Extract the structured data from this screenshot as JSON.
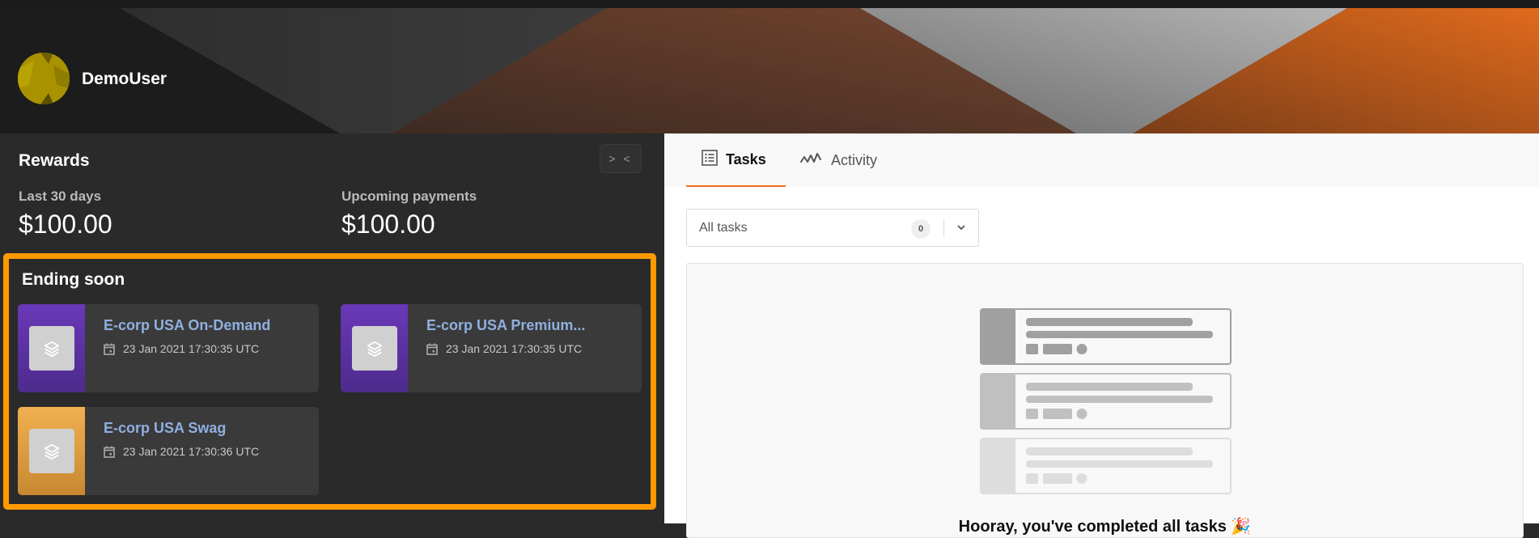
{
  "header": {
    "username": "DemoUser",
    "avatar_icon": "user-avatar-icon"
  },
  "rewards": {
    "title": "Rewards",
    "collapse_label": "> <",
    "last_30_days": {
      "label": "Last 30 days",
      "value": "$100.00"
    },
    "upcoming_payments": {
      "label": "Upcoming payments",
      "value": "$100.00"
    }
  },
  "ending_soon": {
    "title": "Ending soon",
    "items": [
      {
        "title": "E-corp USA On-Demand",
        "date": "23 Jan 2021 17:30:35 UTC",
        "color": "#6a38b8"
      },
      {
        "title": "E-corp USA Premium...",
        "date": "23 Jan 2021 17:30:35 UTC",
        "color": "#6a38b8"
      },
      {
        "title": "E-corp USA Swag",
        "date": "23 Jan 2021 17:30:36 UTC",
        "color": "#f0b050"
      }
    ]
  },
  "tabs": [
    {
      "label": "Tasks",
      "icon": "list-icon",
      "active": true
    },
    {
      "label": "Activity",
      "icon": "activity-icon",
      "active": false
    }
  ],
  "filter": {
    "selected": "All tasks",
    "count": "0"
  },
  "empty_state": {
    "message": "Hooray, you've completed all tasks 🎉"
  },
  "colors": {
    "accent": "#f26b1d",
    "highlight_border": "#ff9900",
    "card_title": "#8fb0e0"
  }
}
